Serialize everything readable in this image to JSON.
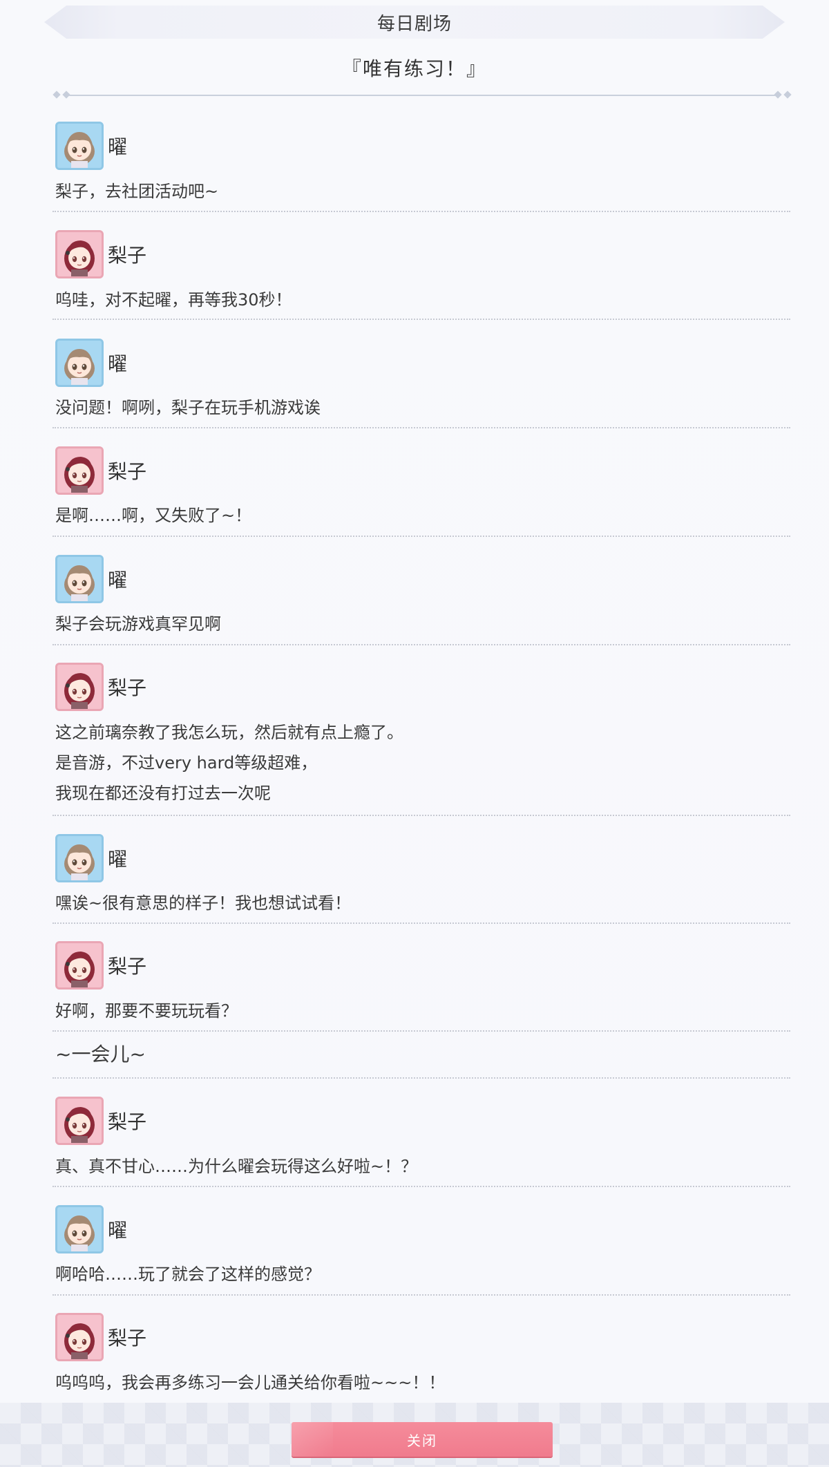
{
  "header": {
    "title": "每日剧场"
  },
  "story": {
    "title": "『唯有练习！』"
  },
  "characters": {
    "you": {
      "name": "曜",
      "avatar_icon": "you-avatar-icon",
      "frame_color": "#8fc7e6"
    },
    "riko": {
      "name": "梨子",
      "avatar_icon": "riko-avatar-icon",
      "frame_color": "#eaa6b4"
    }
  },
  "entries": [
    {
      "speaker": "曜",
      "lines": [
        "梨子，去社团活动吧~"
      ]
    },
    {
      "speaker": "梨子",
      "lines": [
        "呜哇，对不起曜，再等我30秒！"
      ]
    },
    {
      "speaker": "曜",
      "lines": [
        "没问题！啊咧，梨子在玩手机游戏诶"
      ]
    },
    {
      "speaker": "梨子",
      "lines": [
        "是啊……啊，又失败了~！"
      ]
    },
    {
      "speaker": "曜",
      "lines": [
        "梨子会玩游戏真罕见啊"
      ]
    },
    {
      "speaker": "梨子",
      "lines": [
        "这之前璃奈教了我怎么玩，然后就有点上瘾了。",
        "是音游，不过very hard等级超难，",
        "我现在都还没有打过去一次呢"
      ]
    },
    {
      "speaker": "曜",
      "lines": [
        "嘿诶~很有意思的样子！我也想试试看！"
      ]
    },
    {
      "speaker": "梨子",
      "lines": [
        "好啊，那要不要玩玩看？"
      ]
    },
    {
      "narration": "~一会儿~"
    },
    {
      "speaker": "梨子",
      "lines": [
        "真、真不甘心……为什么曜会玩得这么好啦~！？"
      ]
    },
    {
      "speaker": "曜",
      "lines": [
        "啊哈哈……玩了就会了这样的感觉？"
      ]
    },
    {
      "speaker": "梨子",
      "lines": [
        "呜呜呜，我会再多练习一会儿通关给你看啦~~~！！"
      ]
    }
  ],
  "footer": {
    "close_label": "关闭"
  },
  "colors": {
    "close_button": "#f07b8d",
    "divider": "#c6c9d2",
    "background": "#f7f8fc"
  }
}
